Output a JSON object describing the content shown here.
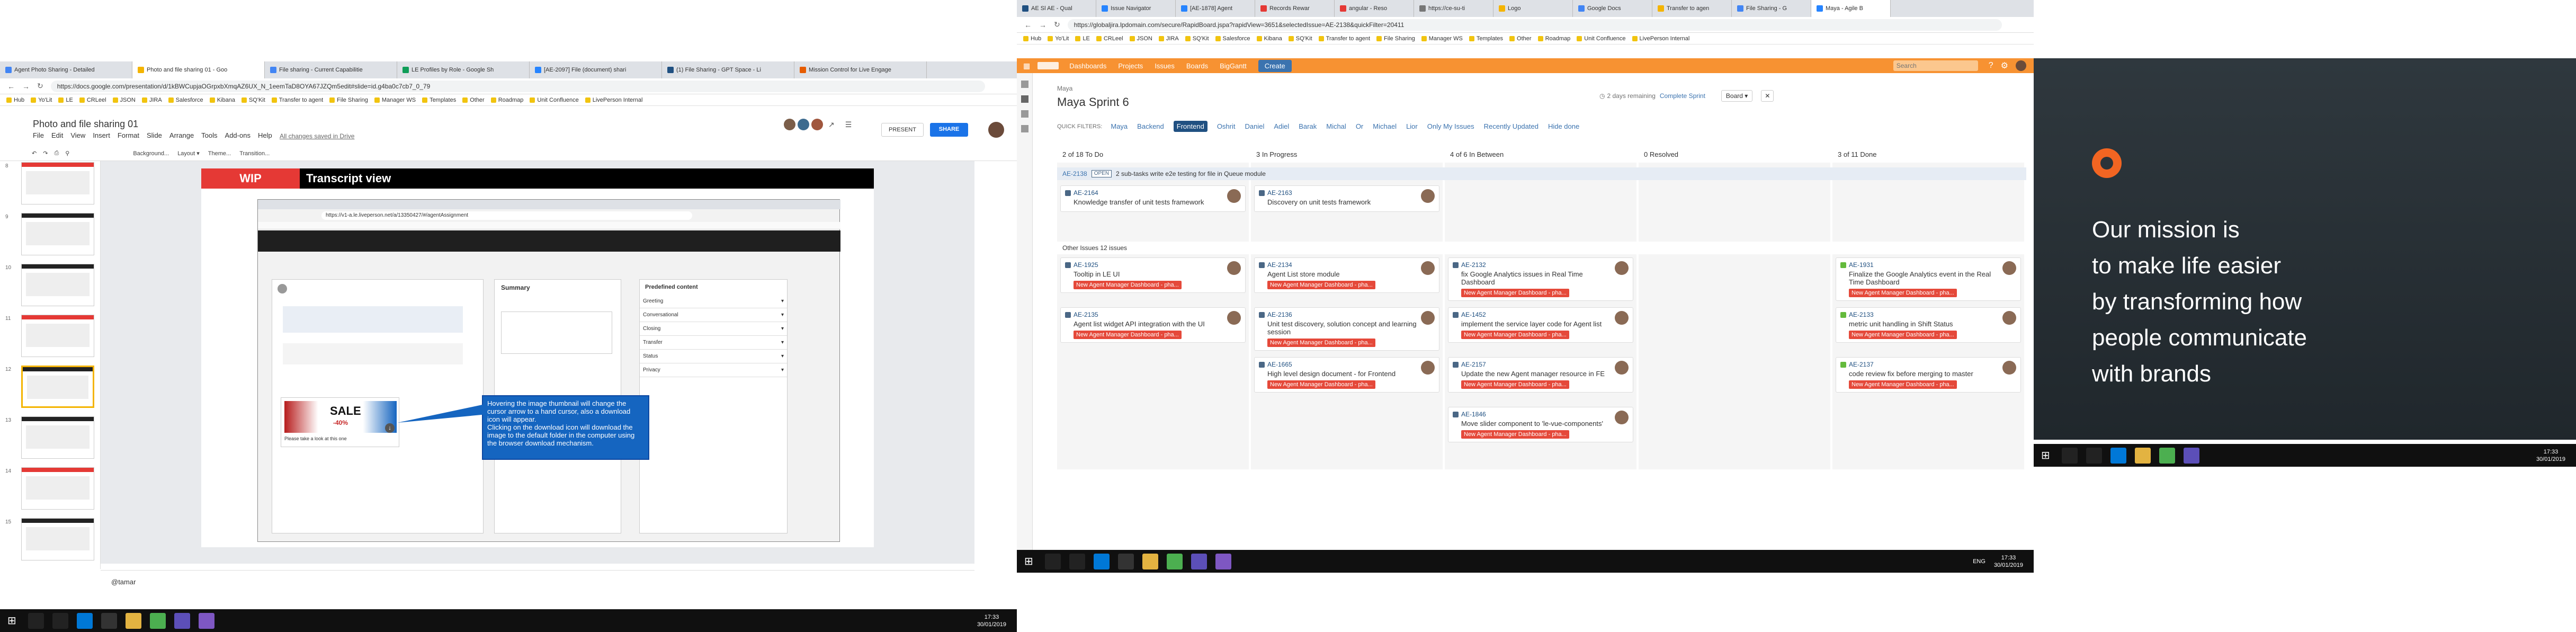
{
  "left": {
    "tabs": [
      "Agent Photo Sharing - Detailed",
      "Photo and file sharing 01 - Goo",
      "File sharing - Current Capabilitie",
      "LE Profiles by Role - Google Sh",
      "[AE-2097] File (document) shari",
      "(1) File Sharing - GPT Space - Li",
      "Mission Control for Live Engage"
    ],
    "url": "https://docs.google.com/presentation/d/1kBWCupjaOGrpxbXmqAZ6UX_N_1eemTaD8OYA67JZQm5edit#slide=id.g4ba0c7cb7_0_79",
    "bookmarks": [
      "Hub",
      "Yo'Lit",
      "LE",
      "CRLeel",
      "JSON",
      "JIRA",
      "Salesforce",
      "Kibana",
      "SQ'Kit",
      "Transfer to agent",
      "File Sharing",
      "Manager WS",
      "Templates",
      "Other",
      "Roadmap",
      "Unit Confluence",
      "LivePerson Internal"
    ],
    "doc_title": "Photo and file sharing 01",
    "menu": [
      "File",
      "Edit",
      "View",
      "Insert",
      "Format",
      "Slide",
      "Arrange",
      "Tools",
      "Add-ons",
      "Help"
    ],
    "saved_text": "All changes saved in Drive",
    "present_label": "PRESENT",
    "share_label": "SHARE",
    "toolbar_items": [
      "Background...",
      "Layout ▾",
      "Theme...",
      "Transition..."
    ],
    "slide": {
      "wip": "WIP",
      "title": "Transcript view",
      "inner_url": "https://v1-a.le.liveperson.net/a/13350427/#/agentAssignment",
      "summary_title": "Summary",
      "predefined_title": "Predefined content",
      "predefined_items": [
        "Greeting",
        "Conversational",
        "Closing",
        "Transfer",
        "Status",
        "Privacy"
      ],
      "sale_text": "SALE",
      "sale_sub": "-40%",
      "chat_text": "Please take a look at this one",
      "callout": "Hovering the image thumbnail will change the cursor arrow to a hand cursor, also a download icon will appear.\nClicking on the download icon will download the image to the default folder in the computer using the browser download mechanism."
    },
    "notes": "@tamar",
    "thumb_nums": [
      "8",
      "9",
      "10",
      "11",
      "12",
      "13",
      "14",
      "15",
      "16"
    ],
    "clock": {
      "time": "17:33",
      "date": "30/01/2019"
    }
  },
  "right": {
    "tabs": [
      "AE Sl AE - Qual",
      "Issue Navigator",
      "[AE-1878] Agent",
      "Records Rewar",
      "angular - Reso",
      "https://ce-su-ti",
      "Logo",
      "Google Docs",
      "Transfer to agen",
      "File Sharing - G",
      "Maya - Agile B"
    ],
    "url": "https://globaljira.lpdomain.com/secure/RapidBoard.jspa?rapidView=3651&selectedIssue=AE-2138&quickFilter=20411",
    "bookmarks": [
      "Hub",
      "Yo'Lit",
      "LE",
      "CRLeel",
      "JSON",
      "JIRA",
      "SQ'Kit",
      "Salesforce",
      "Kibana",
      "SQ'Kit",
      "Transfer to agent",
      "File Sharing",
      "Manager WS",
      "Templates",
      "Other",
      "Roadmap",
      "Unit Confluence",
      "LivePerson Internal"
    ],
    "nav": [
      "Dashboards",
      "Projects",
      "Issues",
      "Boards",
      "BigGantt"
    ],
    "create_label": "Create",
    "search_placeholder": "Search",
    "project": "Maya",
    "sprint": "Maya Sprint 6",
    "days_remaining": "2 days remaining",
    "complete_sprint": "Complete Sprint",
    "board_btn": "Board",
    "quick_filters_label": "QUICK FILTERS:",
    "quick_filters": [
      "Maya",
      "Backend",
      "Frontend",
      "Oshrit",
      "Daniel",
      "Adiel",
      "Barak",
      "Michal",
      "Or",
      "Michael",
      "Lior",
      "Only My Issues",
      "Recently Updated",
      "Hide done"
    ],
    "active_filter": "Frontend",
    "columns": [
      "2 of 18 To Do",
      "3 In Progress",
      "4 of 6 In Between",
      "0 Resolved",
      "3 of 11 Done"
    ],
    "swimlane": {
      "key": "AE-2138",
      "status": "OPEN",
      "text": "2 sub-tasks  write e2e testing for file in Queue module"
    },
    "swim_cards": [
      {
        "key": "AE-2164",
        "summary": "Knowledge transfer of unit tests framework",
        "col": 0
      },
      {
        "key": "AE-2163",
        "summary": "Discovery on unit tests framework",
        "col": 1
      }
    ],
    "other_issues": "Other Issues  12 issues",
    "epic_label": "New Agent Manager Dashboard - pha...",
    "cards": [
      [
        {
          "key": "AE-1925",
          "summary": "Tooltip in LE UI"
        },
        {
          "key": "AE-2135",
          "summary": "Agent list widget API integration with the UI"
        }
      ],
      [
        {
          "key": "AE-2134",
          "summary": "Agent List store module"
        },
        {
          "key": "AE-2136",
          "summary": "Unit test discovery, solution concept and learning session"
        },
        {
          "key": "AE-1665",
          "summary": "High level design document - for Frontend"
        }
      ],
      [
        {
          "key": "AE-2132",
          "summary": "fix Google Analytics issues in Real Time Dashboard"
        },
        {
          "key": "AE-1452",
          "summary": "implement the service layer code for Agent list"
        },
        {
          "key": "AE-2157",
          "summary": "Update the new Agent manager resource in FE"
        },
        {
          "key": "AE-1846",
          "summary": "Move slider component to 'le-vue-components'"
        }
      ],
      [],
      [
        {
          "key": "AE-1931",
          "summary": "Finalize the Google Analytics event in the Real Time Dashboard"
        },
        {
          "key": "AE-2133",
          "summary": "metric unit handling in Shift Status"
        },
        {
          "key": "AE-2137",
          "summary": "code review fix before merging to master"
        }
      ]
    ],
    "clock": {
      "time": "17:33",
      "date": "30/01/2019"
    },
    "lang": "ENG"
  },
  "promo": {
    "lines": [
      "Our mission is",
      "to make life easier",
      "by transforming how",
      "people communicate",
      "with brands"
    ],
    "clock": {
      "time": "17:33",
      "date": "30/01/2019"
    }
  },
  "colors": {
    "jira_nav": "#f79232",
    "epic": "#e5493a",
    "wip": "#e53935",
    "promo_bg": "#2b3339",
    "promo_text": "#ffffff",
    "logo": "#f26522"
  }
}
